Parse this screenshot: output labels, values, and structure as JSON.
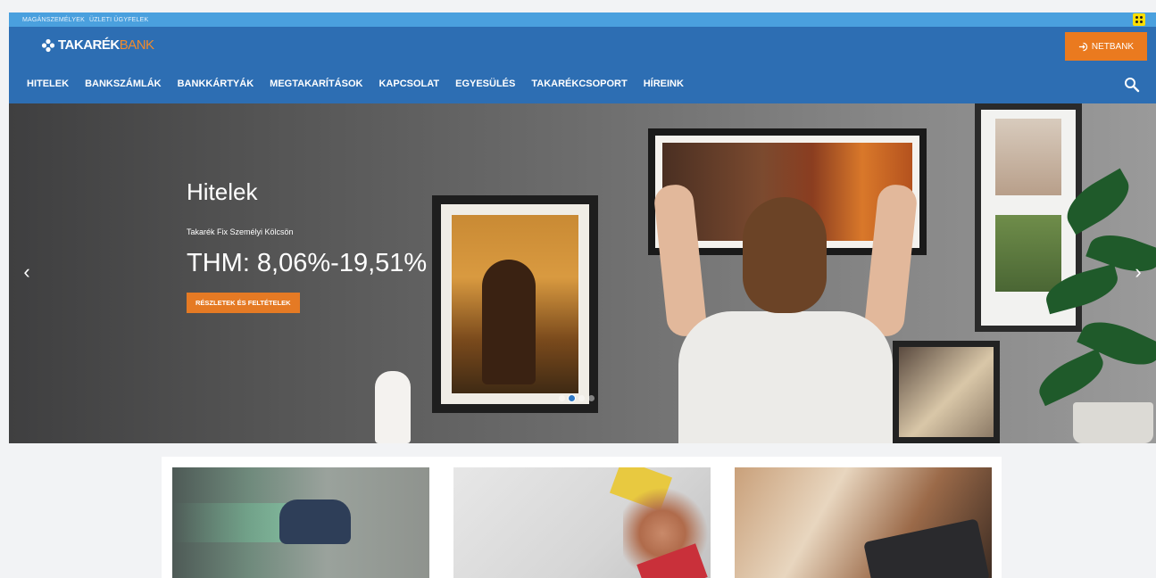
{
  "topbar": {
    "links": [
      "MAGÁNSZEMÉLYEK",
      "ÜZLETI ÜGYFELEK"
    ],
    "accessibility_icon": "accessibility-icon"
  },
  "logo": {
    "part1": "TAKARÉK",
    "part2": "BANK",
    "icon": "takarek-logo-icon"
  },
  "netbank": {
    "label": "NETBANK",
    "icon": "login-arrow-icon"
  },
  "nav": {
    "items": [
      "HITELEK",
      "BANKSZÁMLÁK",
      "BANKKÁRTYÁK",
      "MEGTAKARÍTÁSOK",
      "KAPCSOLAT",
      "EGYESÜLÉS",
      "TAKARÉKCSOPORT",
      "HÍREINK"
    ],
    "search_icon": "search-icon"
  },
  "hero": {
    "title": "Hitelek",
    "subtitle": "Takarék Fix Személyi Kölcsön",
    "thm": "THM: 8,06%-19,51%",
    "button": "RÉSZLETEK ÉS FELTÉTELEK",
    "prev_arrow": "‹",
    "next_arrow": "›",
    "dots": 4,
    "active_dot": 2
  },
  "colors": {
    "topbar": "#4aa0de",
    "header": "#2d6eb3",
    "accent": "#ea7a1f",
    "logo_accent": "#f28a2b"
  }
}
